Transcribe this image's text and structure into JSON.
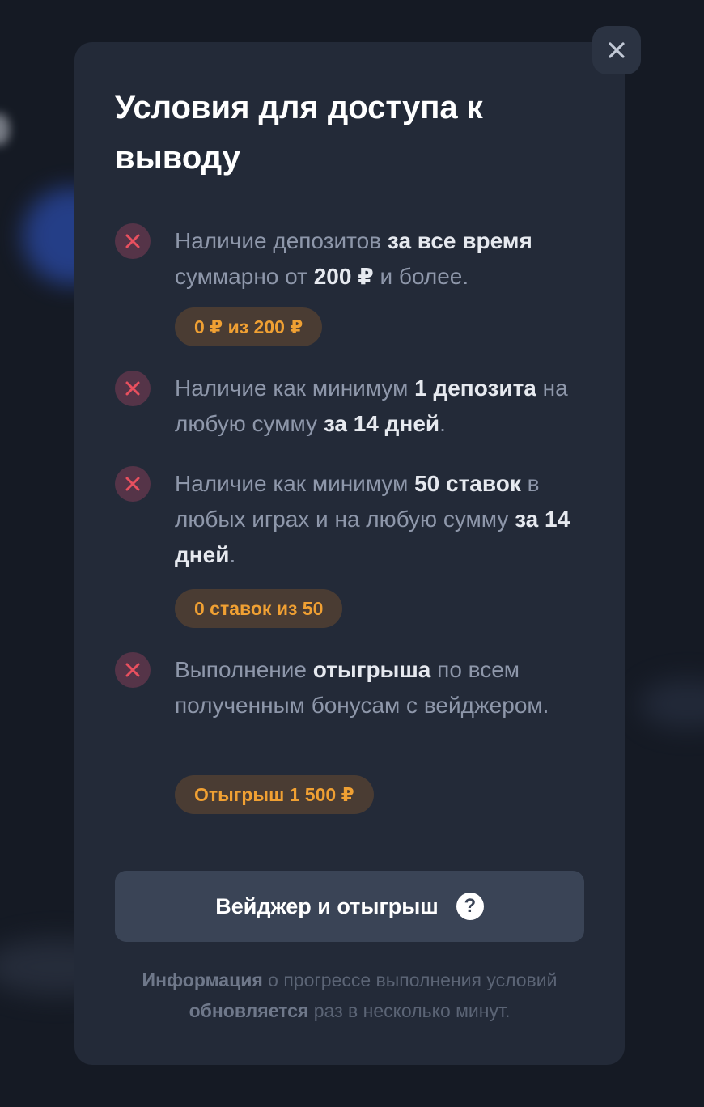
{
  "modal": {
    "title": "Условия для доступа к выводу",
    "conditions": [
      {
        "text_parts": [
          "Наличие депозитов ",
          "за все время",
          " суммарно от ",
          "200 ₽",
          " и более."
        ],
        "status_icon": "x-icon",
        "badge": "0 ₽ из 200 ₽"
      },
      {
        "text_parts": [
          "Наличие как минимум ",
          "1 депозита",
          " на любую сумму ",
          "за 14 дней",
          "."
        ],
        "status_icon": "x-icon"
      },
      {
        "text_parts": [
          "Наличие как минимум ",
          "50 ставок",
          " в любых играх и на любую сумму ",
          "за 14 дней",
          "."
        ],
        "status_icon": "x-icon",
        "badge": "0 ставок из 50"
      },
      {
        "text_parts": [
          "Выполнение ",
          "отыгрыша",
          " по всем полученным бонусам с вейджером."
        ],
        "status_icon": "x-icon",
        "badge": "Отыгрыш 1 500 ₽"
      }
    ],
    "wager_button": {
      "label": "Вейджер и отыгрыш",
      "icon": "help-icon",
      "icon_glyph": "?"
    },
    "footer_parts": [
      "Информация",
      " о прогрессе выполнения условий ",
      "обновляется",
      " раз в несколько минут."
    ]
  },
  "colors": {
    "modal_bg": "#232a38",
    "status_fail": "#e8505f",
    "badge_text": "#f0a033",
    "button_bg": "#3a4456"
  }
}
